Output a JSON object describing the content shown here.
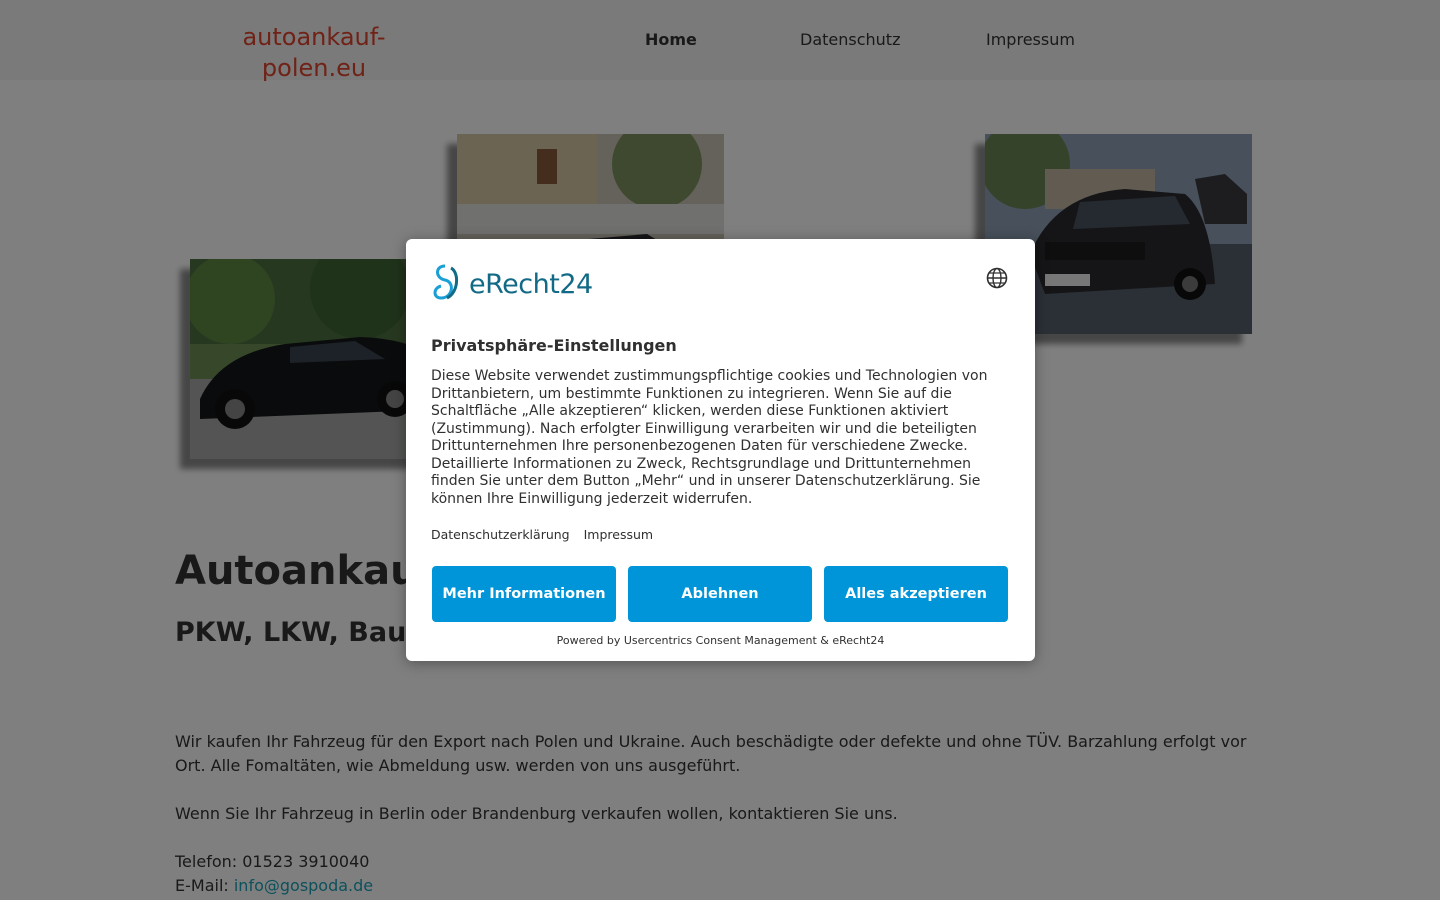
{
  "header": {
    "logo": "autoankauf-polen.eu",
    "nav": {
      "home": "Home",
      "datenschutz": "Datenschutz",
      "impressum": "Impressum"
    }
  },
  "main": {
    "heading": "Autoankauf",
    "subheading": "PKW, LKW, Bau",
    "paragraph1": "Wir kaufen Ihr Fahrzeug für den Export nach Polen und Ukraine. Auch  beschädigte oder defekte und ohne TÜV. Barzahlung erfolgt vor Ort. Alle Fomaltäten, wie Abmeldung usw. werden von uns ausgeführt.",
    "paragraph2": "Wenn Sie Ihr Fahrzeug in Berlin oder Brandenburg verkaufen wollen, kontaktieren Sie uns.",
    "phone": "Telefon: 01523 3910040",
    "email_label": "E-Mail: ",
    "email": "info@gospoda.de"
  },
  "consent": {
    "brand": "eRecht24",
    "title": "Privatsphäre-Einstellungen",
    "description": "Diese Website verwendet zustimmungspflichtige cookies und Technologien von Drittanbietern, um bestimmte Funktionen zu integrieren. Wenn Sie auf die Schaltfläche „Alle akzeptieren“ klicken, werden diese Funktionen aktiviert (Zustimmung). Nach erfolgter Einwilligung verarbeiten wir und die beteiligten Drittunternehmen Ihre personenbezogenen Daten für verschiedene Zwecke. Detaillierte Informationen zu Zweck, Rechtsgrundlage und Drittunternehmen finden Sie unter dem Button „Mehr“ und in unserer Datenschutzerklärung. Sie können Ihre Einwilligung jederzeit widerrufen.",
    "link_privacy": "Datenschutzerklärung",
    "link_imprint": "Impressum",
    "btn_more": "Mehr Informationen",
    "btn_decline": "Ablehnen",
    "btn_accept": "Alles akzeptieren",
    "powered_by": "Powered by Usercentrics Consent Management & eRecht24"
  },
  "icons": {
    "language": "globe-icon",
    "brand_logo": "erecht24-logo-icon"
  },
  "colors": {
    "logo": "#e0452f",
    "button": "#0095d9",
    "brand": "#126a86",
    "link": "#1aa3b8"
  }
}
